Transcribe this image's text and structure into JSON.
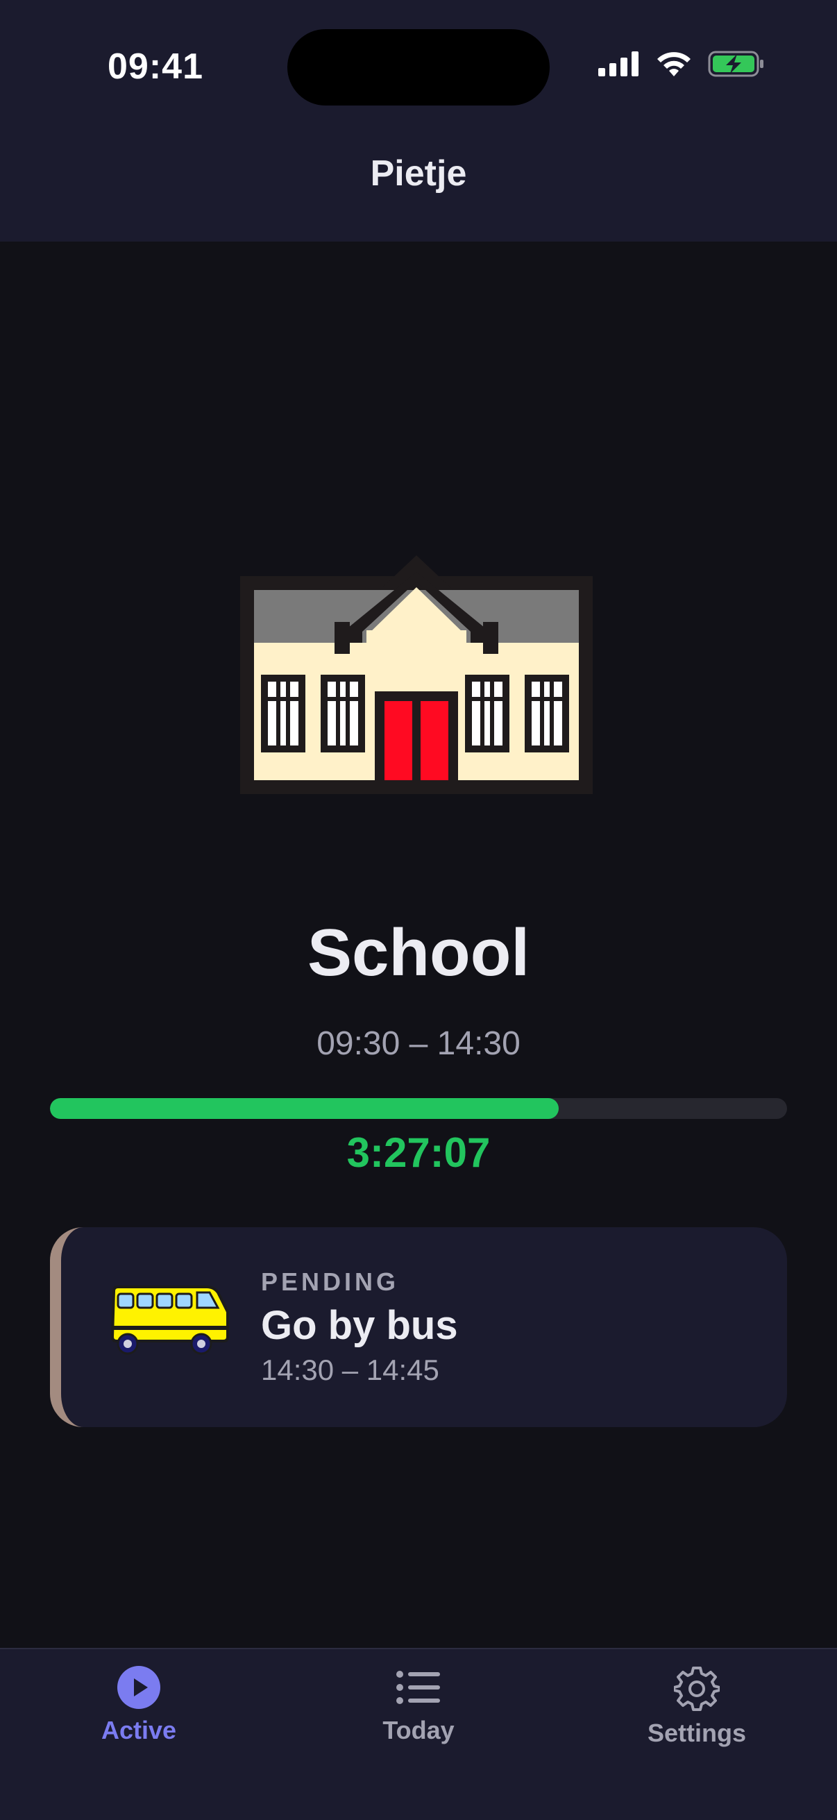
{
  "status_bar": {
    "time": "09:41"
  },
  "header": {
    "title": "Pietje"
  },
  "activity": {
    "icon": "school-icon",
    "name": "School",
    "time_range": "09:30 – 14:30",
    "progress_fraction": 0.69,
    "remaining": "3:27:07",
    "progress_color": "#22c55e"
  },
  "next_card": {
    "icon": "bus-icon",
    "status": "PENDING",
    "title": "Go by bus",
    "time_range": "14:30 – 14:45",
    "accent_color": "#a38b80"
  },
  "tabs": [
    {
      "label": "Active",
      "icon": "play-circle-icon",
      "active": true
    },
    {
      "label": "Today",
      "icon": "list-icon",
      "active": false
    },
    {
      "label": "Settings",
      "icon": "gear-icon",
      "active": false
    }
  ],
  "colors": {
    "accent": "#7b7cf0",
    "background": "#111117",
    "panel": "#1b1b2e"
  }
}
